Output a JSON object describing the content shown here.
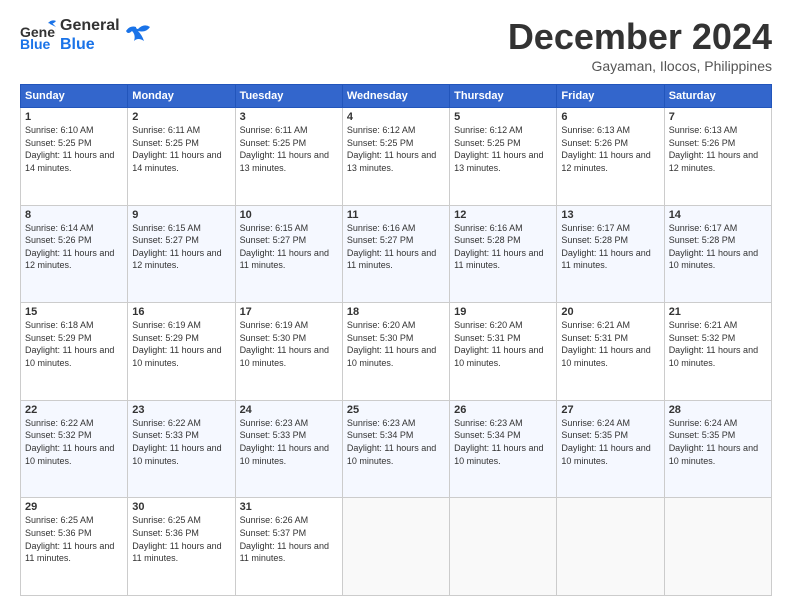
{
  "logo": {
    "line1": "General",
    "line2": "Blue"
  },
  "header": {
    "month": "December 2024",
    "location": "Gayaman, Ilocos, Philippines"
  },
  "weekdays": [
    "Sunday",
    "Monday",
    "Tuesday",
    "Wednesday",
    "Thursday",
    "Friday",
    "Saturday"
  ],
  "weeks": [
    [
      {
        "day": "1",
        "sunrise": "6:10 AM",
        "sunset": "5:25 PM",
        "daylight": "11 hours and 14 minutes."
      },
      {
        "day": "2",
        "sunrise": "6:11 AM",
        "sunset": "5:25 PM",
        "daylight": "11 hours and 14 minutes."
      },
      {
        "day": "3",
        "sunrise": "6:11 AM",
        "sunset": "5:25 PM",
        "daylight": "11 hours and 13 minutes."
      },
      {
        "day": "4",
        "sunrise": "6:12 AM",
        "sunset": "5:25 PM",
        "daylight": "11 hours and 13 minutes."
      },
      {
        "day": "5",
        "sunrise": "6:12 AM",
        "sunset": "5:25 PM",
        "daylight": "11 hours and 13 minutes."
      },
      {
        "day": "6",
        "sunrise": "6:13 AM",
        "sunset": "5:26 PM",
        "daylight": "11 hours and 12 minutes."
      },
      {
        "day": "7",
        "sunrise": "6:13 AM",
        "sunset": "5:26 PM",
        "daylight": "11 hours and 12 minutes."
      }
    ],
    [
      {
        "day": "8",
        "sunrise": "6:14 AM",
        "sunset": "5:26 PM",
        "daylight": "11 hours and 12 minutes."
      },
      {
        "day": "9",
        "sunrise": "6:15 AM",
        "sunset": "5:27 PM",
        "daylight": "11 hours and 12 minutes."
      },
      {
        "day": "10",
        "sunrise": "6:15 AM",
        "sunset": "5:27 PM",
        "daylight": "11 hours and 11 minutes."
      },
      {
        "day": "11",
        "sunrise": "6:16 AM",
        "sunset": "5:27 PM",
        "daylight": "11 hours and 11 minutes."
      },
      {
        "day": "12",
        "sunrise": "6:16 AM",
        "sunset": "5:28 PM",
        "daylight": "11 hours and 11 minutes."
      },
      {
        "day": "13",
        "sunrise": "6:17 AM",
        "sunset": "5:28 PM",
        "daylight": "11 hours and 11 minutes."
      },
      {
        "day": "14",
        "sunrise": "6:17 AM",
        "sunset": "5:28 PM",
        "daylight": "11 hours and 10 minutes."
      }
    ],
    [
      {
        "day": "15",
        "sunrise": "6:18 AM",
        "sunset": "5:29 PM",
        "daylight": "11 hours and 10 minutes."
      },
      {
        "day": "16",
        "sunrise": "6:19 AM",
        "sunset": "5:29 PM",
        "daylight": "11 hours and 10 minutes."
      },
      {
        "day": "17",
        "sunrise": "6:19 AM",
        "sunset": "5:30 PM",
        "daylight": "11 hours and 10 minutes."
      },
      {
        "day": "18",
        "sunrise": "6:20 AM",
        "sunset": "5:30 PM",
        "daylight": "11 hours and 10 minutes."
      },
      {
        "day": "19",
        "sunrise": "6:20 AM",
        "sunset": "5:31 PM",
        "daylight": "11 hours and 10 minutes."
      },
      {
        "day": "20",
        "sunrise": "6:21 AM",
        "sunset": "5:31 PM",
        "daylight": "11 hours and 10 minutes."
      },
      {
        "day": "21",
        "sunrise": "6:21 AM",
        "sunset": "5:32 PM",
        "daylight": "11 hours and 10 minutes."
      }
    ],
    [
      {
        "day": "22",
        "sunrise": "6:22 AM",
        "sunset": "5:32 PM",
        "daylight": "11 hours and 10 minutes."
      },
      {
        "day": "23",
        "sunrise": "6:22 AM",
        "sunset": "5:33 PM",
        "daylight": "11 hours and 10 minutes."
      },
      {
        "day": "24",
        "sunrise": "6:23 AM",
        "sunset": "5:33 PM",
        "daylight": "11 hours and 10 minutes."
      },
      {
        "day": "25",
        "sunrise": "6:23 AM",
        "sunset": "5:34 PM",
        "daylight": "11 hours and 10 minutes."
      },
      {
        "day": "26",
        "sunrise": "6:23 AM",
        "sunset": "5:34 PM",
        "daylight": "11 hours and 10 minutes."
      },
      {
        "day": "27",
        "sunrise": "6:24 AM",
        "sunset": "5:35 PM",
        "daylight": "11 hours and 10 minutes."
      },
      {
        "day": "28",
        "sunrise": "6:24 AM",
        "sunset": "5:35 PM",
        "daylight": "11 hours and 10 minutes."
      }
    ],
    [
      {
        "day": "29",
        "sunrise": "6:25 AM",
        "sunset": "5:36 PM",
        "daylight": "11 hours and 11 minutes."
      },
      {
        "day": "30",
        "sunrise": "6:25 AM",
        "sunset": "5:36 PM",
        "daylight": "11 hours and 11 minutes."
      },
      {
        "day": "31",
        "sunrise": "6:26 AM",
        "sunset": "5:37 PM",
        "daylight": "11 hours and 11 minutes."
      },
      null,
      null,
      null,
      null
    ]
  ],
  "labels": {
    "sunrise": "Sunrise: ",
    "sunset": "Sunset: ",
    "daylight": "Daylight: "
  }
}
